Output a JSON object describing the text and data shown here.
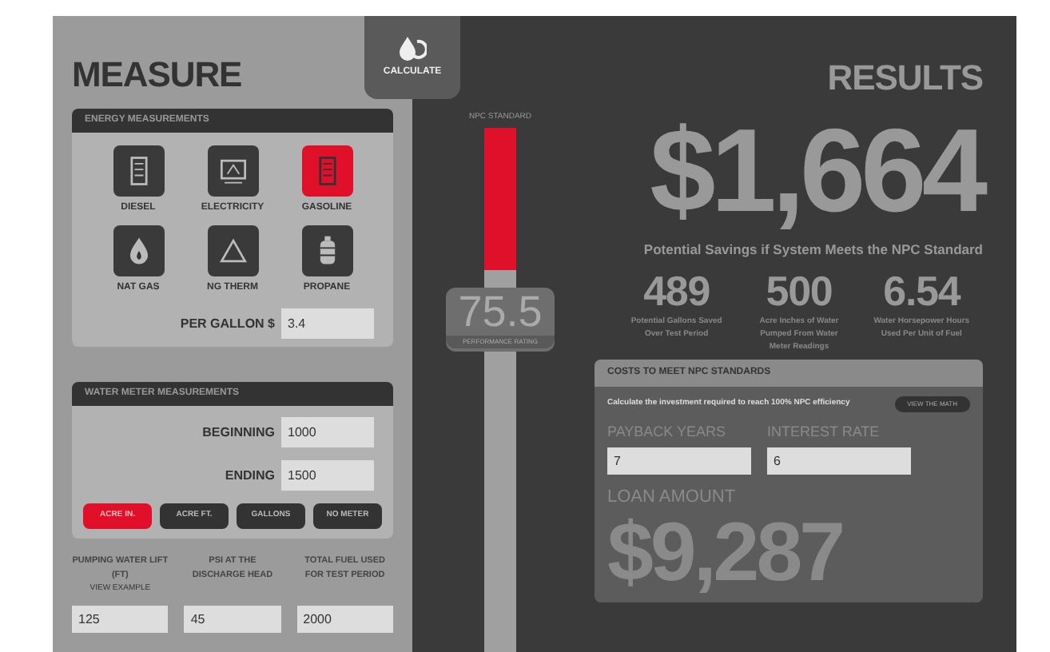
{
  "measure": {
    "title": "MEASURE",
    "energy": {
      "title": "ENERGY MEASUREMENTS",
      "fuels": [
        {
          "label": "DIESEL",
          "selected": false
        },
        {
          "label": "ELECTRICITY",
          "selected": false
        },
        {
          "label": "GASOLINE",
          "selected": true
        },
        {
          "label": "NAT GAS",
          "selected": false
        },
        {
          "label": "NG THERM",
          "selected": false
        },
        {
          "label": "PROPANE",
          "selected": false
        }
      ],
      "price": {
        "label": "PER GALLON $",
        "value": "3.4"
      }
    },
    "water": {
      "title": "WATER METER MEASUREMENTS",
      "fields": [
        {
          "label": "BEGINNING",
          "value": "1000"
        },
        {
          "label": "ENDING",
          "value": "1500"
        }
      ],
      "units": [
        {
          "label": "ACRE IN.",
          "selected": true
        },
        {
          "label": "ACRE FT.",
          "selected": false
        },
        {
          "label": "GALLONS",
          "selected": false
        },
        {
          "label": "NO METER",
          "selected": false
        }
      ]
    },
    "inputs": [
      {
        "label": "PUMPING WATER LIFT (FT)",
        "link": "VIEW EXAMPLE",
        "value": "125"
      },
      {
        "label": "PSI AT THE DISCHARGE HEAD",
        "value": "45"
      },
      {
        "label": "TOTAL FUEL USED FOR TEST PERIOD",
        "value": "2000"
      }
    ]
  },
  "calculate_button": "CALCULATE",
  "rating": {
    "label": "NPC STANDARD",
    "value": "75.5",
    "caption": "PERFORMANCE RATING",
    "level": 0.73
  },
  "results": {
    "title": "RESULTS",
    "savings": "$1,664",
    "savings_caption": "Potential Savings if System Meets the NPC Standard",
    "stats": [
      {
        "value": "489",
        "caption": "Potential Gallons Saved Over Test Period"
      },
      {
        "value": "500",
        "caption": "Acre Inches of Water Pumped From Water Meter Readings"
      },
      {
        "value": "6.54",
        "caption": "Water Horsepower Hours Used Per Unit of Fuel"
      }
    ],
    "costs": {
      "title": "COSTS TO MEET NPC STANDARDS",
      "description": "Calculate the investment required to reach 100% NPC efficiency",
      "math_button": "VIEW THE MATH",
      "fields": [
        {
          "label": "PAYBACK YEARS",
          "value": "7"
        },
        {
          "label": "INTEREST RATE",
          "value": "6"
        }
      ],
      "loan_label": "LOAN AMOUNT",
      "loan": "$9,287"
    }
  }
}
